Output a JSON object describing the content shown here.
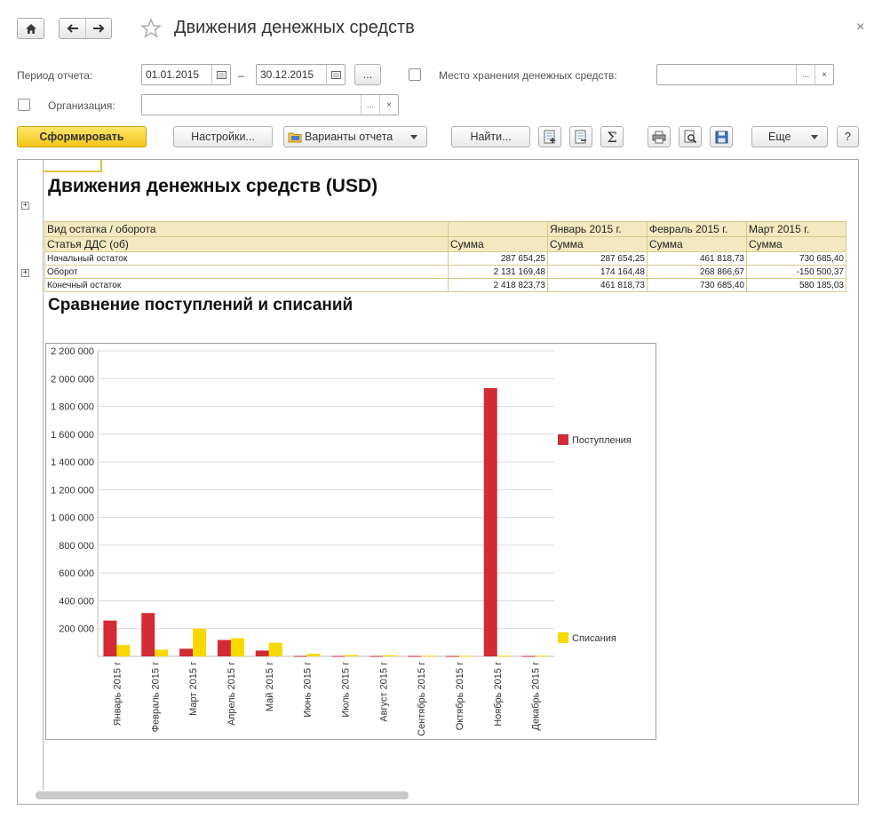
{
  "window": {
    "title": "Движения денежных средств",
    "close_glyph": "×"
  },
  "nav": {
    "home_icon": "home-icon",
    "back_icon": "arrow-left-icon",
    "forward_icon": "arrow-right-icon",
    "favorite_icon": "star-icon"
  },
  "filters": {
    "period_label": "Период отчета:",
    "date_from": "01.01.2015",
    "date_sep": "–",
    "date_to": "30.12.2015",
    "period_select_label": "...",
    "storage_label": "Место хранения денежных средств:",
    "storage_value": "",
    "storage_select": "...",
    "storage_clear": "×",
    "org_label": "Организация:",
    "org_value": "",
    "org_select": "...",
    "org_clear": "×"
  },
  "toolbar": {
    "generate": "Сформировать",
    "settings": "Настройки...",
    "variants": "Варианты отчета",
    "find": "Найти...",
    "more": "Еще",
    "help": "?",
    "sigma": "Σ"
  },
  "report": {
    "title": "Движения денежных средств (USD)",
    "table": {
      "header1": [
        "Вид остатка / оборота",
        "",
        "Январь 2015 г.",
        "Февраль 2015 г.",
        "Март 2015 г."
      ],
      "header2": [
        "Статья ДДС (об)",
        "Сумма",
        "Сумма",
        "Сумма",
        "Сумма"
      ],
      "rows": [
        {
          "label": "Начальный остаток",
          "total": "287 654,25",
          "m1": "287 654,25",
          "m2": "461 818,73",
          "m3": "730 685,40"
        },
        {
          "label": "Оборот",
          "total": "2 131 169,48",
          "m1": "174 164,48",
          "m2": "268 866,67",
          "m3": "-150 500,37"
        },
        {
          "label": "Конечный остаток",
          "total": "2 418 823,73",
          "m1": "461 818,73",
          "m2": "730 685,40",
          "m3": "580 185,03"
        }
      ]
    },
    "chart_title": "Сравнение поступлений и списаний"
  },
  "chart_data": {
    "type": "bar",
    "categories": [
      "Январь 2015 г.",
      "Февраль 2015 г.",
      "Март 2015 г.",
      "Апрель 2015 г.",
      "Май 2015 г.",
      "Июнь 2015 г.",
      "Июль 2015 г.",
      "Август 2015 г.",
      "Сентябрь 2015 г.",
      "Октябрь 2015 г.",
      "Ноябрь 2015 г.",
      "Декабрь 2015 г."
    ],
    "category_labels": [
      "Январь 2015 г",
      "Февраль 2015 г",
      "Март 2015 г",
      "Апрель 2015 г",
      "Май 2015 г",
      "Июнь 2015 г",
      "Июль 2015 г",
      "Август 2015 г",
      "Сентябрь 2015 г",
      "Октябрь 2015 г",
      "Ноябрь 2015 г",
      "Декабрь 2015 г"
    ],
    "series": [
      {
        "name": "Поступления",
        "color": "#d22b36",
        "values": [
          258000,
          312000,
          55000,
          118000,
          42000,
          3000,
          3000,
          3000,
          3000,
          3000,
          1932000,
          3000
        ]
      },
      {
        "name": "Списания",
        "color": "#f7d800",
        "values": [
          82000,
          48000,
          200000,
          131000,
          98000,
          18000,
          10000,
          8000,
          5000,
          4000,
          5000,
          5000
        ]
      }
    ],
    "yticks": [
      "200 000",
      "400 000",
      "600 000",
      "800 000",
      "1 000 000",
      "1 200 000",
      "1 400 000",
      "1 600 000",
      "1 800 000",
      "2 000 000",
      "2 200 000"
    ],
    "ylim": [
      0,
      2200000
    ],
    "grid": true,
    "legend": "right"
  }
}
